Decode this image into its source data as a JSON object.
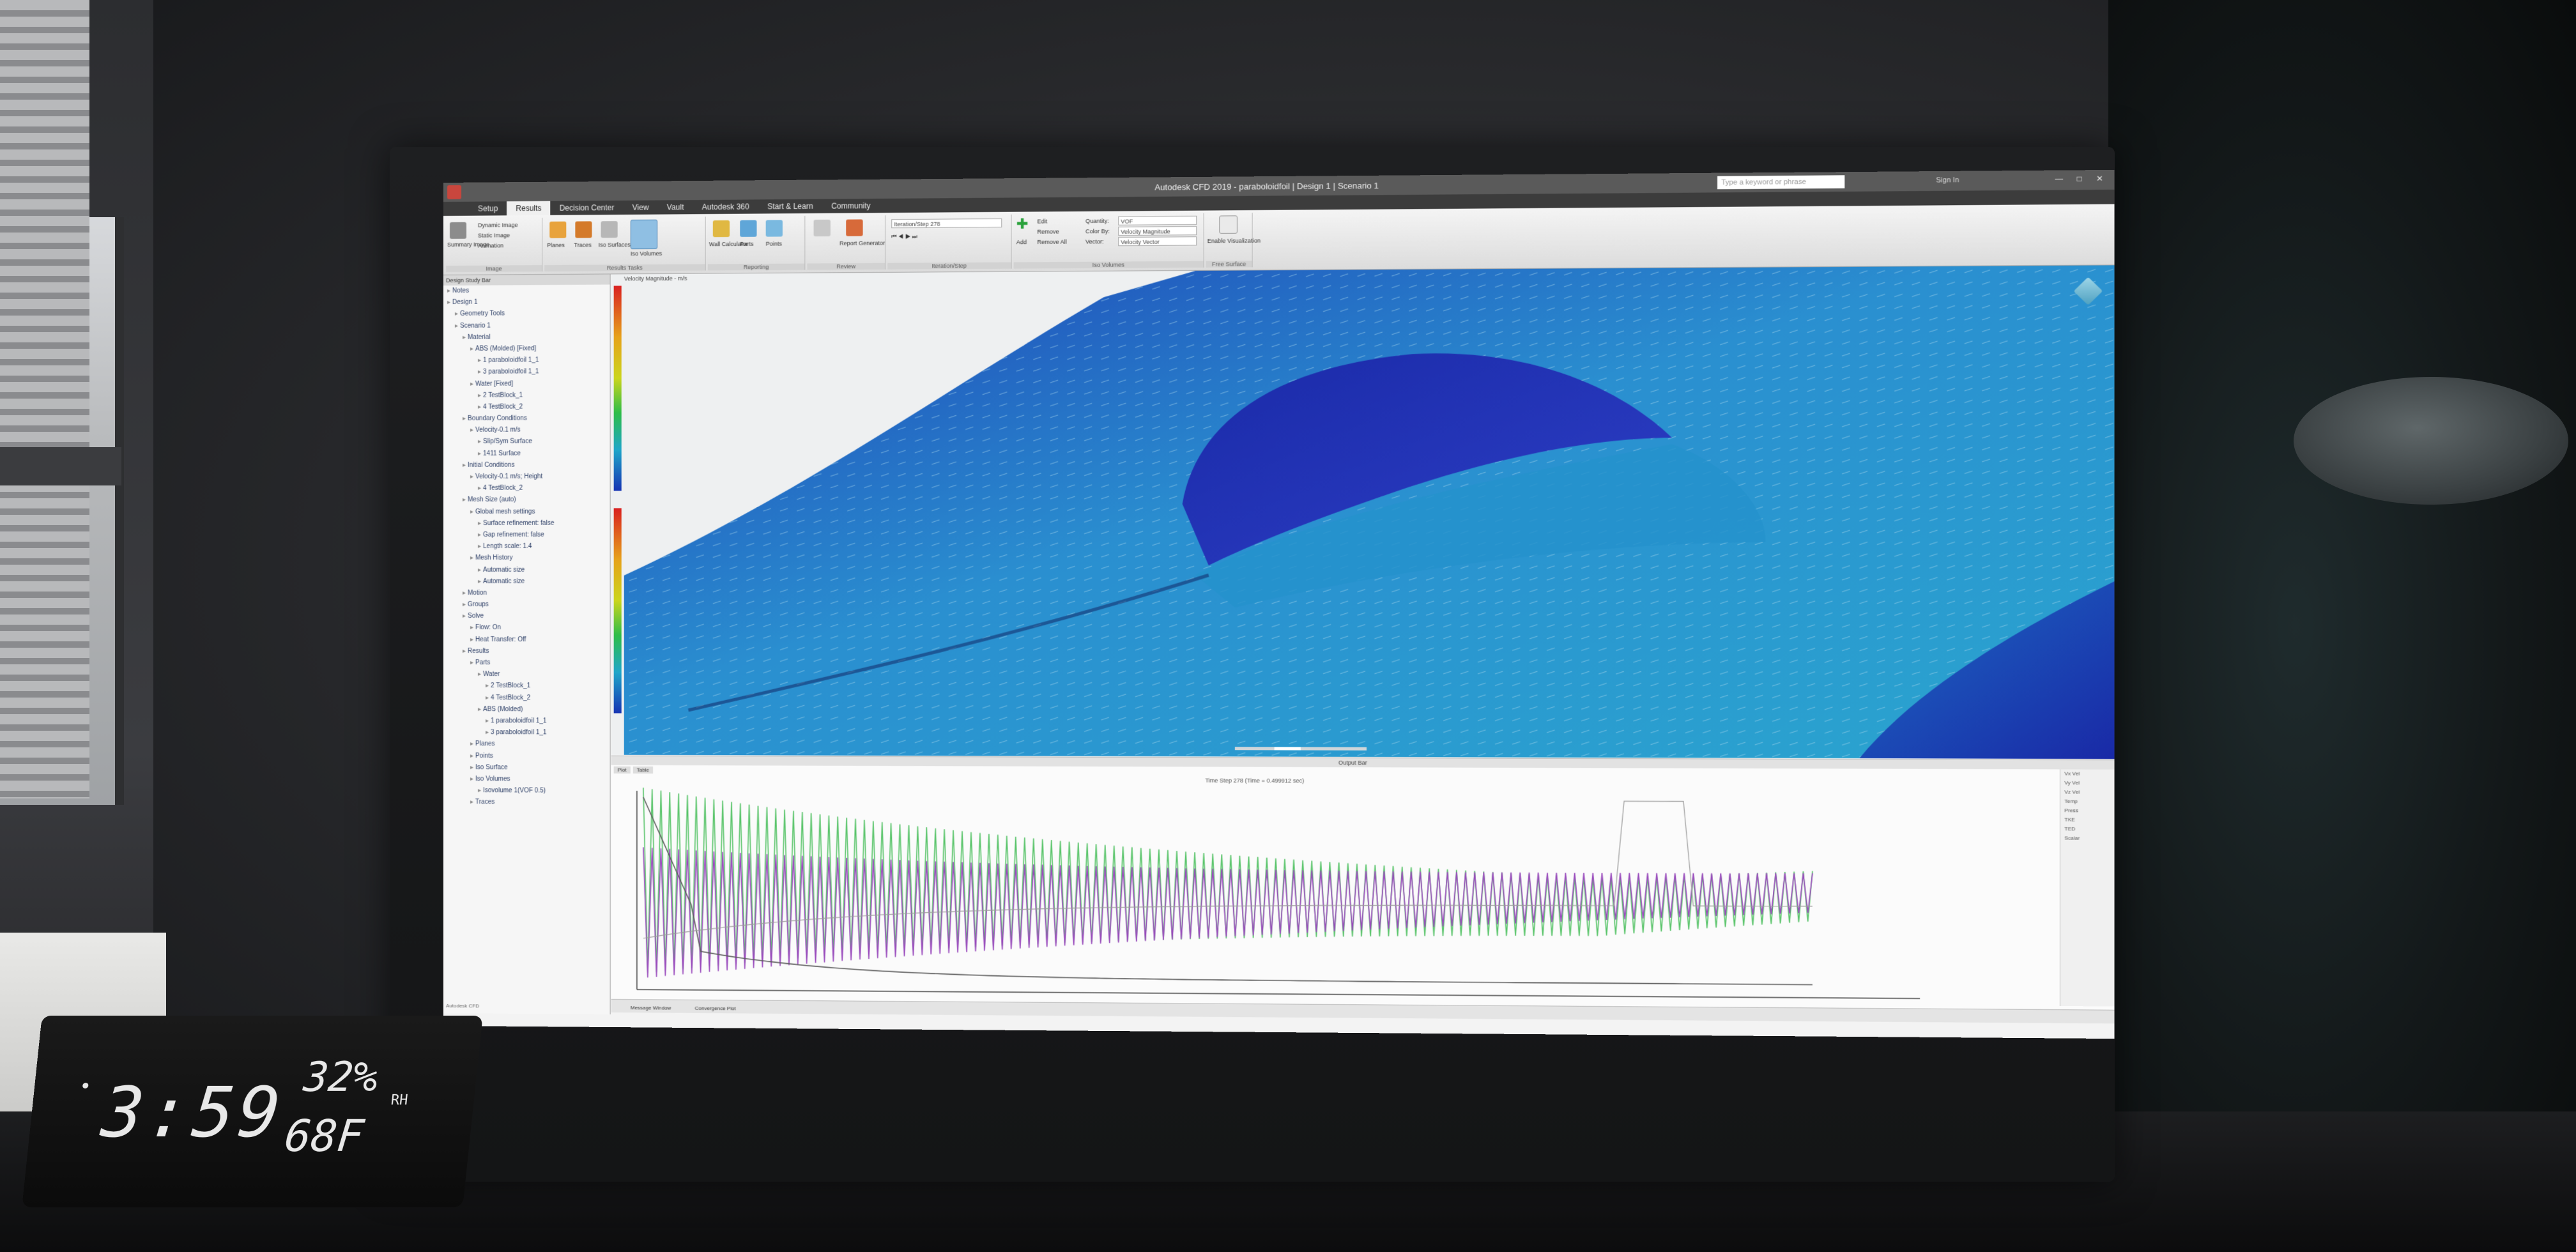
{
  "app": {
    "title": "Autodesk CFD 2019 - paraboloidfoil | Design 1 | Scenario 1",
    "search_placeholder": "Type a keyword or phrase",
    "sign_in": "Sign In",
    "menu_tabs": [
      "Setup",
      "Results",
      "Decision Center",
      "View",
      "Vault",
      "Autodesk 360",
      "Start & Learn",
      "Community"
    ],
    "active_tab": "Results"
  },
  "ribbon": {
    "image_group": {
      "summary_image": "Summary Image",
      "dynamic_image": "Dynamic Image",
      "static_image": "Static Image",
      "animation": "Animation",
      "title": "Image"
    },
    "results_tasks": {
      "planes": "Planes",
      "traces": "Traces",
      "iso_surfaces": "Iso Surfaces",
      "iso_volumes": "Iso Volumes",
      "title": "Results Tasks"
    },
    "reporting": {
      "wall_calculator": "Wall Calculator",
      "parts": "Parts",
      "points": "Points",
      "title": "Reporting"
    },
    "review": {
      "review_label": "Review",
      "report_generator": "Report Generator",
      "title": "Review"
    },
    "iteration_step": {
      "value": "Iteration/Step 278",
      "title": "Iteration/Step"
    },
    "iso_volumes": {
      "add": "Add",
      "edit": "Edit",
      "remove": "Remove",
      "remove_all": "Remove All",
      "quantity_label": "Quantity:",
      "quantity_value": "VOF",
      "color_by_label": "Color By:",
      "color_by_value": "Velocity Magnitude",
      "vector_label": "Vector:",
      "vector_value": "Velocity Vector",
      "title": "Iso Volumes"
    },
    "free_surface": {
      "label": "Enable Visualization",
      "title": "Free Surface"
    }
  },
  "tree": {
    "header": "Design Study Bar",
    "items": [
      {
        "label": "Notes",
        "indent": 0
      },
      {
        "label": "Design 1",
        "indent": 0
      },
      {
        "label": "Geometry Tools",
        "indent": 1
      },
      {
        "label": "Scenario 1",
        "indent": 1
      },
      {
        "label": "Material",
        "indent": 2
      },
      {
        "label": "ABS (Molded) [Fixed]",
        "indent": 3
      },
      {
        "label": "1 paraboloidfoil 1_1",
        "indent": 4
      },
      {
        "label": "3 paraboloidfoil 1_1",
        "indent": 4
      },
      {
        "label": "Water [Fixed]",
        "indent": 3
      },
      {
        "label": "2 TestBlock_1",
        "indent": 4
      },
      {
        "label": "4 TestBlock_2",
        "indent": 4
      },
      {
        "label": "Boundary Conditions",
        "indent": 2
      },
      {
        "label": "Velocity-0.1 m/s",
        "indent": 3
      },
      {
        "label": "Slip/Sym Surface",
        "indent": 4
      },
      {
        "label": "1411 Surface",
        "indent": 4
      },
      {
        "label": "Initial Conditions",
        "indent": 2
      },
      {
        "label": "Velocity-0.1 m/s; Height",
        "indent": 3
      },
      {
        "label": "4 TestBlock_2",
        "indent": 4
      },
      {
        "label": "Mesh Size (auto)",
        "indent": 2
      },
      {
        "label": "Global mesh settings",
        "indent": 3
      },
      {
        "label": "Surface refinement: false",
        "indent": 4
      },
      {
        "label": "Gap refinement: false",
        "indent": 4
      },
      {
        "label": "Length scale: 1.4",
        "indent": 4
      },
      {
        "label": "Mesh History",
        "indent": 3
      },
      {
        "label": "Automatic size",
        "indent": 4
      },
      {
        "label": "Automatic size",
        "indent": 4
      },
      {
        "label": "Motion",
        "indent": 2
      },
      {
        "label": "Groups",
        "indent": 2
      },
      {
        "label": "Solve",
        "indent": 2
      },
      {
        "label": "Flow: On",
        "indent": 3
      },
      {
        "label": "Heat Transfer: Off",
        "indent": 3
      },
      {
        "label": "Results",
        "indent": 2
      },
      {
        "label": "Parts",
        "indent": 3
      },
      {
        "label": "Water",
        "indent": 4
      },
      {
        "label": "2 TestBlock_1",
        "indent": 5
      },
      {
        "label": "4 TestBlock_2",
        "indent": 5
      },
      {
        "label": "ABS (Molded)",
        "indent": 4
      },
      {
        "label": "1 paraboloidfoil 1_1",
        "indent": 5
      },
      {
        "label": "3 paraboloidfoil 1_1",
        "indent": 5
      },
      {
        "label": "Planes",
        "indent": 3
      },
      {
        "label": "Points",
        "indent": 3
      },
      {
        "label": "Iso Surface",
        "indent": 3
      },
      {
        "label": "Iso Volumes",
        "indent": 3
      },
      {
        "label": "Isovolume 1(VOF 0.5)",
        "indent": 4
      },
      {
        "label": "Traces",
        "indent": 3
      }
    ]
  },
  "viewport": {
    "legend_title": "Velocity Magnitude - m/s"
  },
  "graph": {
    "header": "Output Bar",
    "tabs": [
      "Plot",
      "Table"
    ],
    "caption": "Time Step 278 (Time = 0.499912 sec)",
    "side_lines": [
      "Vx Vel",
      "Vy Vel",
      "Vz Vel",
      "Temp",
      "Press",
      "TKE",
      "TED",
      "Scalar"
    ],
    "status_tabs": [
      "Message Window",
      "Convergence Plot"
    ],
    "status_left": "Autodesk CFD"
  },
  "clock": {
    "time": "3:59",
    "humidity": "32%",
    "humidity_unit": "RH",
    "temperature": "68F"
  },
  "colors": {
    "fluid_dark": "#1a2aa8",
    "fluid_mid": "#1f6fc7",
    "fluid_light": "#2ea6cf",
    "series_green": "#59c46a",
    "series_purple": "#9a4bbd",
    "series_dark": "#5b5b5b"
  }
}
